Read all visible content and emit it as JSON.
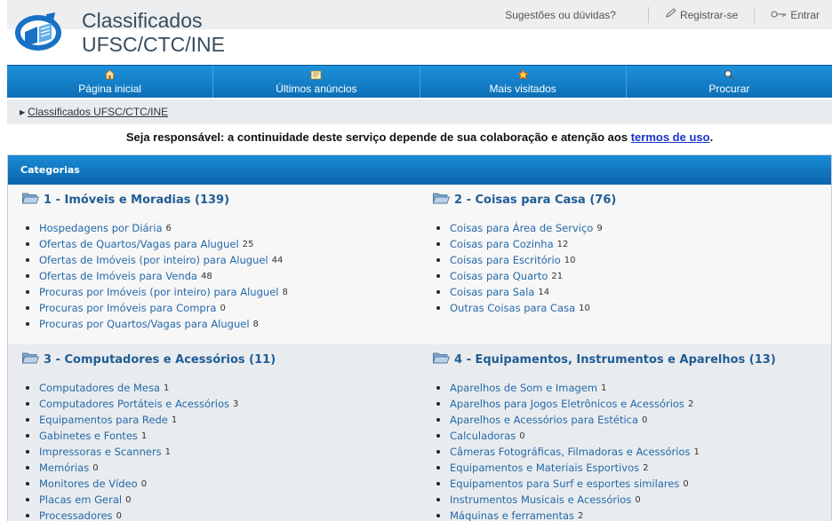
{
  "header": {
    "title_line1": "Classificados",
    "title_line2": "UFSC/CTC/INE",
    "links": [
      "Sugestões ou dúvidas?",
      "Registrar-se",
      "Entrar"
    ]
  },
  "nav": [
    {
      "label": "Página inicial",
      "icon": "home-icon"
    },
    {
      "label": "Últimos anúncios",
      "icon": "newspaper-icon"
    },
    {
      "label": "Mais visitados",
      "icon": "star-icon"
    },
    {
      "label": "Procurar",
      "icon": "magnifier-icon"
    }
  ],
  "breadcrumb": "Classificados UFSC/CTC/INE",
  "notice": {
    "text": "Seja responsável: a continuidade deste serviço depende de sua colaboração e atenção aos ",
    "link": "termos de uso",
    "end": "."
  },
  "categories": {
    "header": "Categorias",
    "groups": [
      {
        "title": "1 - Imóveis e Moradias (139)",
        "items": [
          {
            "label": "Hospedagens por Diária",
            "count": "6"
          },
          {
            "label": "Ofertas de Quartos/Vagas para Aluguel",
            "count": "25"
          },
          {
            "label": "Ofertas de Imóveis (por inteiro) para Aluguel",
            "count": "44"
          },
          {
            "label": "Ofertas de Imóveis para Venda",
            "count": "48"
          },
          {
            "label": "Procuras por Imóveis (por inteiro) para Aluguel",
            "count": "8"
          },
          {
            "label": "Procuras por Imóveis para Compra",
            "count": "0"
          },
          {
            "label": "Procuras por Quartos/Vagas para Aluguel",
            "count": "8"
          }
        ]
      },
      {
        "title": "2 - Coisas para Casa (76)",
        "items": [
          {
            "label": "Coisas para Área de Serviço",
            "count": "9"
          },
          {
            "label": "Coisas para Cozinha",
            "count": "12"
          },
          {
            "label": "Coisas para Escritório",
            "count": "10"
          },
          {
            "label": "Coisas para Quarto",
            "count": "21"
          },
          {
            "label": "Coisas para Sala",
            "count": "14"
          },
          {
            "label": "Outras Coisas para Casa",
            "count": "10"
          }
        ]
      },
      {
        "title": "3 - Computadores e Acessórios (11)",
        "items": [
          {
            "label": "Computadores de Mesa",
            "count": "1"
          },
          {
            "label": "Computadores Portáteis e Acessórios",
            "count": "3"
          },
          {
            "label": "Equipamentos para Rede",
            "count": "1"
          },
          {
            "label": "Gabinetes e Fontes",
            "count": "1"
          },
          {
            "label": "Impressoras e Scanners",
            "count": "1"
          },
          {
            "label": "Memórias",
            "count": "0"
          },
          {
            "label": "Monitores de Vídeo",
            "count": "0"
          },
          {
            "label": "Placas em Geral",
            "count": "0"
          },
          {
            "label": "Processadores",
            "count": "0"
          }
        ]
      },
      {
        "title": "4 - Equipamentos, Instrumentos e Aparelhos (13)",
        "items": [
          {
            "label": "Aparelhos de Som e Imagem",
            "count": "1"
          },
          {
            "label": "Aparelhos para Jogos Eletrônicos e Acessórios",
            "count": "2"
          },
          {
            "label": "Aparelhos e Acessórios para Estética",
            "count": "0"
          },
          {
            "label": "Calculadoras",
            "count": "0"
          },
          {
            "label": "Câmeras Fotográficas, Filmadoras e Acessórios",
            "count": "1"
          },
          {
            "label": "Equipamentos e Materiais Esportivos",
            "count": "2"
          },
          {
            "label": "Equipamentos para Surf e esportes similares",
            "count": "0"
          },
          {
            "label": "Instrumentos Musicais e Acessórios",
            "count": "0"
          },
          {
            "label": "Máquinas e ferramentas",
            "count": "2"
          }
        ]
      }
    ]
  },
  "colors": {
    "nav_bar": "#1580c9",
    "link": "#2468a8",
    "category_title": "#1f5d95",
    "terms_link": "#1a33cc"
  }
}
